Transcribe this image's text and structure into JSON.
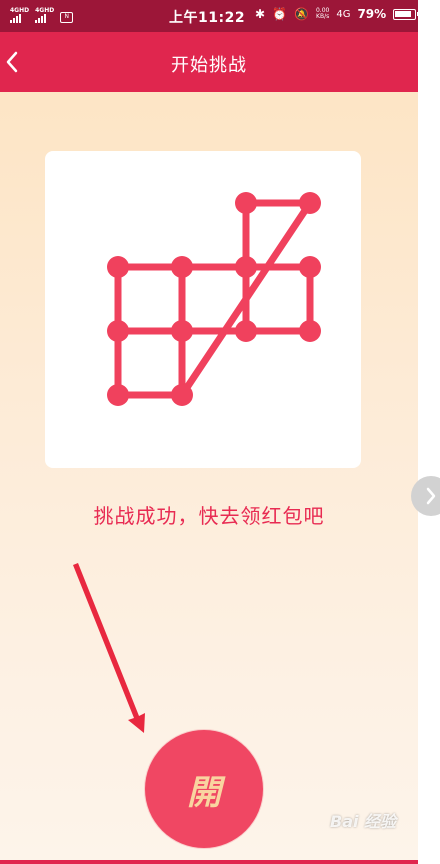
{
  "status_bar": {
    "sim1": "4GHD",
    "sim2": "4GHD",
    "time": "上午11:22",
    "net_speed": "0.00\nKB/s",
    "network": "4G",
    "battery": "79%"
  },
  "nav": {
    "title": "开始挑战"
  },
  "pattern": {
    "dot_color": "#f0415d",
    "line_color": "#f0415d",
    "path_order": [
      [
        1,
        3
      ],
      [
        0,
        3
      ],
      [
        0,
        2
      ],
      [
        0,
        1
      ],
      [
        1,
        1
      ],
      [
        2,
        1
      ],
      [
        3,
        1
      ],
      [
        3,
        2
      ],
      [
        2,
        2
      ],
      [
        1,
        2
      ],
      [
        0,
        2
      ]
    ],
    "extra_segments": [
      [
        [
          1,
          3
        ],
        [
          1,
          1
        ]
      ],
      [
        [
          1,
          3
        ],
        [
          3,
          0
        ]
      ],
      [
        [
          2,
          0
        ],
        [
          3,
          0
        ]
      ],
      [
        [
          2,
          0
        ],
        [
          2,
          2
        ]
      ]
    ],
    "dots": [
      [
        2,
        0
      ],
      [
        3,
        0
      ],
      [
        0,
        1
      ],
      [
        1,
        1
      ],
      [
        2,
        1
      ],
      [
        3,
        1
      ],
      [
        0,
        2
      ],
      [
        1,
        2
      ],
      [
        2,
        2
      ],
      [
        3,
        2
      ],
      [
        0,
        3
      ],
      [
        1,
        3
      ]
    ]
  },
  "result": {
    "message": "挑战成功，快去领红包吧"
  },
  "open_button": {
    "label": "開"
  },
  "watermark": {
    "text": "Bai 经验"
  },
  "colors": {
    "status_bar": "#9c1638",
    "nav_bar": "#e0264e",
    "accent": "#e82b52",
    "button": "#f04763"
  }
}
